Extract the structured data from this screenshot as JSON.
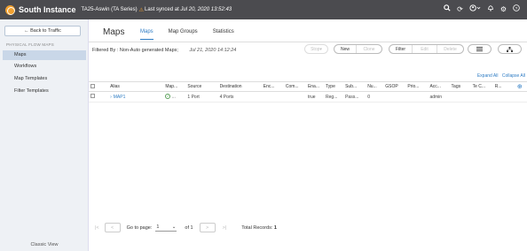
{
  "header": {
    "brand": "South Instance",
    "cluster": "TA25-Aswin (TA Series)",
    "sync_prefix": "Last synced at ",
    "sync_time": "Jul 20, 2020 13:52:43",
    "icons": [
      "search-icon",
      "refresh-icon",
      "user-icon",
      "bell-icon",
      "settings-icon",
      "help-icon"
    ]
  },
  "sidebar": {
    "back_label": "← Back to Traffic",
    "section": "PHYSICAL FLOW MAPS",
    "items": [
      {
        "label": "Maps",
        "active": true
      },
      {
        "label": "Workflows"
      },
      {
        "label": "Map Templates"
      },
      {
        "label": "Filter Templates"
      }
    ],
    "classic_view": "Classic View"
  },
  "main": {
    "title": "Maps",
    "tabs": [
      {
        "label": "Maps",
        "active": true
      },
      {
        "label": "Map Groups"
      },
      {
        "label": "Statistics"
      }
    ],
    "filter_label": "Filtered By : Non-Auto generated Maps;",
    "filter_date": "Jul 21, 2020 14:12:24",
    "actions": {
      "stop": "Stop",
      "new": "New",
      "clone": "Clone",
      "filter": "Filter",
      "edit": "Edit",
      "delete": "Delete",
      "view_icon": "list-view-icon",
      "topology_icon": "topology-icon"
    },
    "expand_all": "Expand All",
    "collapse_all": "Collapse All"
  },
  "table": {
    "columns": [
      "Alias",
      "Map...",
      "Source",
      "Destination",
      "Enc...",
      "Com...",
      "Ena...",
      "Type",
      "Sub...",
      "Nu...",
      "GSOP",
      "Prio...",
      "Acc...",
      "Tags",
      "Te C...",
      "R..."
    ],
    "rows": [
      {
        "alias": "MAP1",
        "map_status": "...",
        "source": "1 Port",
        "destination": "4 Ports",
        "enc": "",
        "com": "",
        "enabled": "true",
        "type": "Reg...",
        "sub": "Pass...",
        "num": "0",
        "gsop": "",
        "prio": "",
        "access": "admin",
        "tags": "",
        "te": "",
        "r": ""
      }
    ]
  },
  "pager": {
    "go_to_label": "Go to page:",
    "page": "1",
    "of_label": "of 1",
    "total_label": "Total Records:",
    "total": "1"
  },
  "colors": {
    "header_bg": "#4b4b4f",
    "accent": "#2e7cc4",
    "logo": "#f0a030",
    "sidebar_bg": "#eef1f5",
    "active_item": "#c9d7e8"
  }
}
